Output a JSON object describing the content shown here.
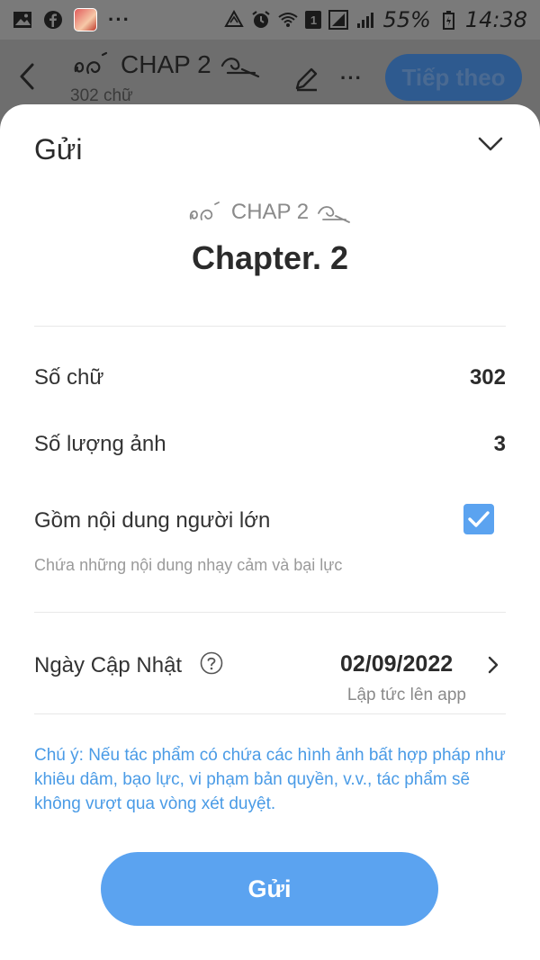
{
  "status_bar": {
    "battery_text": "55%",
    "time": "14:38",
    "sim_slot": "1",
    "more": "···"
  },
  "editor": {
    "title": "CHAP 2",
    "word_count": "302 chữ",
    "more": "···",
    "next_label": "Tiếp theo"
  },
  "sheet": {
    "title": "Gửi",
    "chapter_label": "CHAP 2",
    "chapter_name": "Chapter. 2",
    "word_count_label": "Số chữ",
    "word_count_value": "302",
    "image_count_label": "Số lượng ảnh",
    "image_count_value": "3",
    "adult_label": "Gồm nội dung người lớn",
    "adult_checked": true,
    "adult_desc": "Chứa những nội dung nhạy cảm và bại lực",
    "update_label": "Ngày Cập Nhật",
    "update_date": "02/09/2022",
    "update_sub": "Lập tức lên app",
    "notice": "Chú ý: Nếu tác phẩm có chứa các hình ảnh bất hợp pháp như khiêu dâm, bạo lực, vi phạm bản quyền, v.v., tác phẩm sẽ không vượt qua vòng xét duyệt.",
    "send_label": "Gửi"
  },
  "colors": {
    "accent": "#5ba3f0",
    "notice": "#4a9be6",
    "overlay": "#6e6e6e"
  },
  "icons": [
    "gallery-icon",
    "facebook-icon",
    "alarm-icon",
    "wifi-icon",
    "signal-icon",
    "battery-icon",
    "back-icon",
    "pen-icon",
    "collapse-icon",
    "help-icon",
    "chevron-right-icon",
    "checkmark-icon",
    "swirl-decoration-icon"
  ]
}
